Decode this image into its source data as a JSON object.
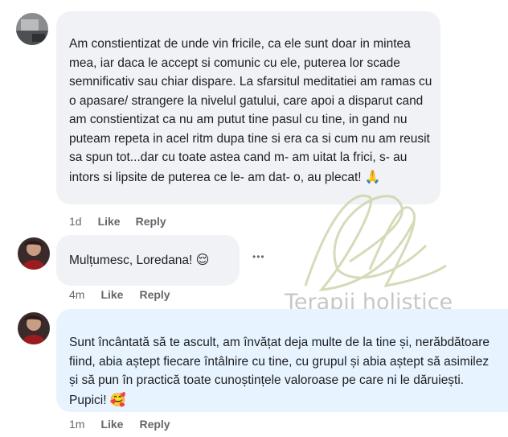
{
  "comments": [
    {
      "text": "Am constientizat de unde vin fricile, ca ele sunt doar in mintea mea, iar daca le accept si comunic cu ele, puterea lor scade semnificativ sau chiar dispare. La sfarsitul meditatiei am ramas cu o apasare/ strangere la nivelul gatului, care apoi a disparut cand am constientizat ca nu am putut tine pasul cu tine, in gand nu puteam repeta in acel ritm dupa tine si era ca si cum nu am reusit sa spun tot...dar cu toate astea cand m- am uitat la frici, s- au intors si lipsite de puterea ce le- am dat- o, au plecat!",
      "emoji": "🙏",
      "time": "1d",
      "like": "Like",
      "reply": "Reply"
    },
    {
      "text": "Mulțumesc, Loredana!",
      "emoji": "😌",
      "time": "4m",
      "like": "Like",
      "reply": "Reply",
      "more": "•••"
    },
    {
      "text": "Sunt încântată să te ascult, am învățat deja multe de la tine și, nerăbdătoare fiind, abia aștept fiecare întâlnire cu tine, cu grupul și abia aștept să asimilez și să pun în practică toate cunoștințele valoroase pe care ni le dăruiești. Pupici!",
      "emoji": "🥰",
      "time": "1m",
      "like": "Like",
      "reply": "Reply"
    }
  ],
  "watermark": {
    "text": "Terapii holistice"
  },
  "colors": {
    "bubble_gray": "#f0f2f5",
    "bubble_blue": "#e7f3ff",
    "meta_text": "#65676b",
    "body_text": "#1c1e21"
  }
}
